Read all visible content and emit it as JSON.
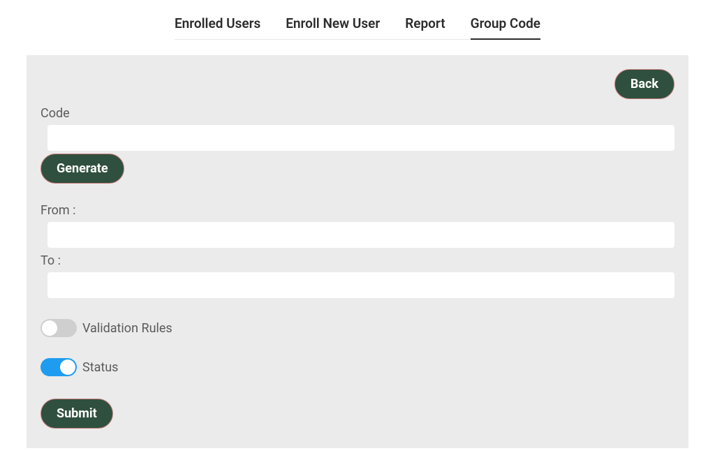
{
  "tabs": {
    "enrolled_users": "Enrolled Users",
    "enroll_new_user": "Enroll New User",
    "report": "Report",
    "group_code": "Group Code"
  },
  "active_tab": "group_code",
  "buttons": {
    "back": "Back",
    "generate": "Generate",
    "submit": "Submit"
  },
  "form": {
    "code_label": "Code",
    "code_value": "",
    "from_label": "From :",
    "from_value": "",
    "to_label": "To :",
    "to_value": "",
    "validation_rules_label": "Validation Rules",
    "validation_rules_on": false,
    "status_label": "Status",
    "status_on": true
  }
}
